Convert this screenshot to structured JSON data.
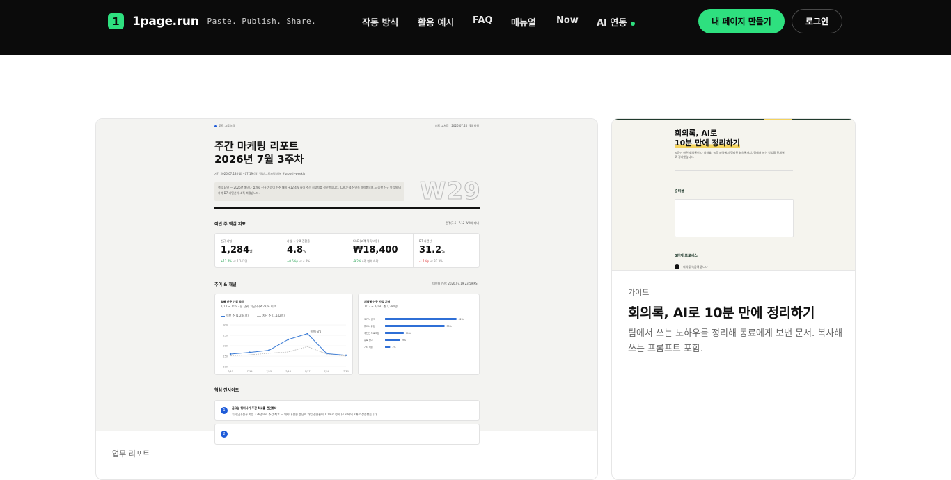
{
  "header": {
    "logo_glyph": "1",
    "brand": "1page.run",
    "tagline": "Paste. Publish. Share.",
    "nav": [
      "작동 방식",
      "활용 예시",
      "FAQ",
      "매뉴얼",
      "Now",
      "AI 연동"
    ],
    "cta": "내 페이지 만들기",
    "login": "로그인",
    "accent": "#2ee07f"
  },
  "main_card": {
    "category": "업무 리포트",
    "preview": {
      "org": "루트 그로스팀",
      "meta_right": "새로 고쳐짐 · 2026.07.20 (월) 발행",
      "title_line1": "주간 마케팅 리포트",
      "title_line2": "2026년 7월 3주차",
      "period": "기간 2026.07.13 (월) - 07.19 (일)   작성 그로스팀   채널 #growth-weekly",
      "summary": "핵심 요약 — 2026년 매바나 효과로 신규 가입이 전주 대비 +12.4% 늘어 주간 최고치를 경신했습니다. CAC는 4주 연속 하락했으며, 급증한 신규 유입에 비하여 D7 리텐션이 소폭 빠졌습니다.",
      "week_badge": "W29",
      "kpi_section": "이번 주 핵심 지표",
      "kpi_section_note": "전주(7.6~7.12 W28) 대비",
      "kpis": [
        {
          "label": "신규 가입",
          "value": "1,284",
          "unit": "명",
          "delta": "+12.4%",
          "delta_note": "vs 1,142명",
          "dir": "up"
        },
        {
          "label": "가입 → 유료 전환율",
          "value": "4.8",
          "unit": "%",
          "delta": "+0.6%p",
          "delta_note": "vs 4.2%",
          "dir": "up"
        },
        {
          "label": "CAC (고객 획득 비용)",
          "value": "₩18,400",
          "unit": "",
          "delta": "-9.2%",
          "delta_note": "4주 연속 하락",
          "dir": "up"
        },
        {
          "label": "D7 리텐션",
          "value": "31.2",
          "unit": "%",
          "delta": "-1.1%p",
          "delta_note": "vs 32.3%",
          "dir": "down"
        }
      ],
      "trend_section": "추이 & 채널",
      "trend_note": "데이터 기준: 2026.07.19 23:59 KST",
      "line_chart_title": "일별 신규 가입 추이",
      "line_chart_sub": "7/13 ~ 7/19 · 전 단위, 지난 주(W28)와 비교",
      "line_legend": [
        "이번 주 (1,284명)",
        "지난 주 (1,142명)"
      ],
      "bar_chart_title": "채널별 신규 가입 기여",
      "bar_chart_sub": "7/13 ~ 7/19 · 총 1,284명",
      "insights_section": "핵심 인사이트",
      "insight1_title": "금요일 웨비나가 주간 최고를 견인했다",
      "insight1_body": "지식(금) 신규 가입 236명으로 주간 최고 — 웨비나 전환 랜딩의 가입 전환율이 7.1%로 평시 (4.3%)의 2배로 상승했습니다."
    },
    "colors": {
      "series_this_week": "#3a7bd5",
      "series_last_week": "#b8b8b8",
      "bar": "#2f6fd6",
      "down": "#dd3333",
      "up": "#1b9e4b"
    }
  },
  "side_card": {
    "category": "가이드",
    "title": "회의록, AI로 10분 만에 정리하기",
    "description": "팀에서 쓰는 노하우를 정리해 동료에게 보낸 문서. 복사해 쓰는 프롬프트 포함.",
    "preview": {
      "title_line1": "회의록, AI로",
      "title_line2": "10분 만에 정리하기",
      "intro": "녹음만 하면 회의록이 다 나와요. 녹음 파일에서 정리된 회의록까지, 팀에서 쓰는 방법을 단계별로 정리했습니다.",
      "prep_heading": "준비물",
      "steps_heading": "3단계 프로세스",
      "step1": "회의를 녹음해 둡니다"
    }
  },
  "chart_data": [
    {
      "type": "line",
      "title": "일별 신규 가입 추이",
      "x": [
        "7/13",
        "7/14",
        "7/15",
        "7/16",
        "7/17",
        "7/18",
        "7/19"
      ],
      "series": [
        {
          "name": "이번 주 (1,284명)",
          "values": [
            160,
            168,
            178,
            230,
            258,
            162,
            154
          ]
        },
        {
          "name": "지난 주 (1,142명)",
          "values": [
            152,
            156,
            164,
            170,
            196,
            160,
            150
          ]
        }
      ],
      "ylim": [
        100,
        300
      ],
      "annotation": "웨비나 당일"
    },
    {
      "type": "bar",
      "title": "채널별 신규 가입 기여",
      "categories": [
        "오가닉 검색",
        "웨비나 유입",
        "추천인 프로그램",
        "유료 광고",
        "기타 채널"
      ],
      "values": [
        42,
        35,
        11,
        9,
        3
      ],
      "unit": "%",
      "xlim": [
        0,
        45
      ]
    }
  ]
}
